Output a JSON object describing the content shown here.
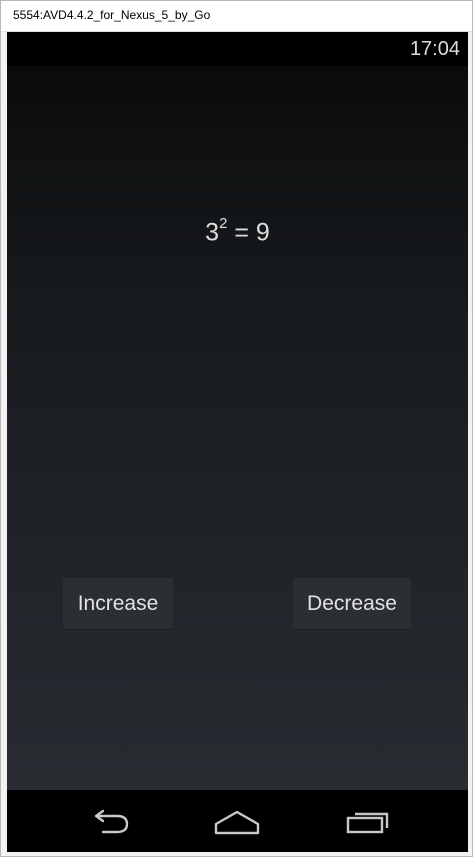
{
  "window": {
    "title": "5554:AVD4.4.2_for_Nexus_5_by_Go"
  },
  "statusbar": {
    "time": "17:04"
  },
  "main": {
    "base": "3",
    "exponent": "2",
    "equals_result": " = 9"
  },
  "buttons": {
    "increase_label": "Increase",
    "decrease_label": "Decrease"
  },
  "navbar": {
    "back_icon": "back-icon",
    "home_icon": "home-icon",
    "recent_icon": "recent-apps-icon"
  }
}
